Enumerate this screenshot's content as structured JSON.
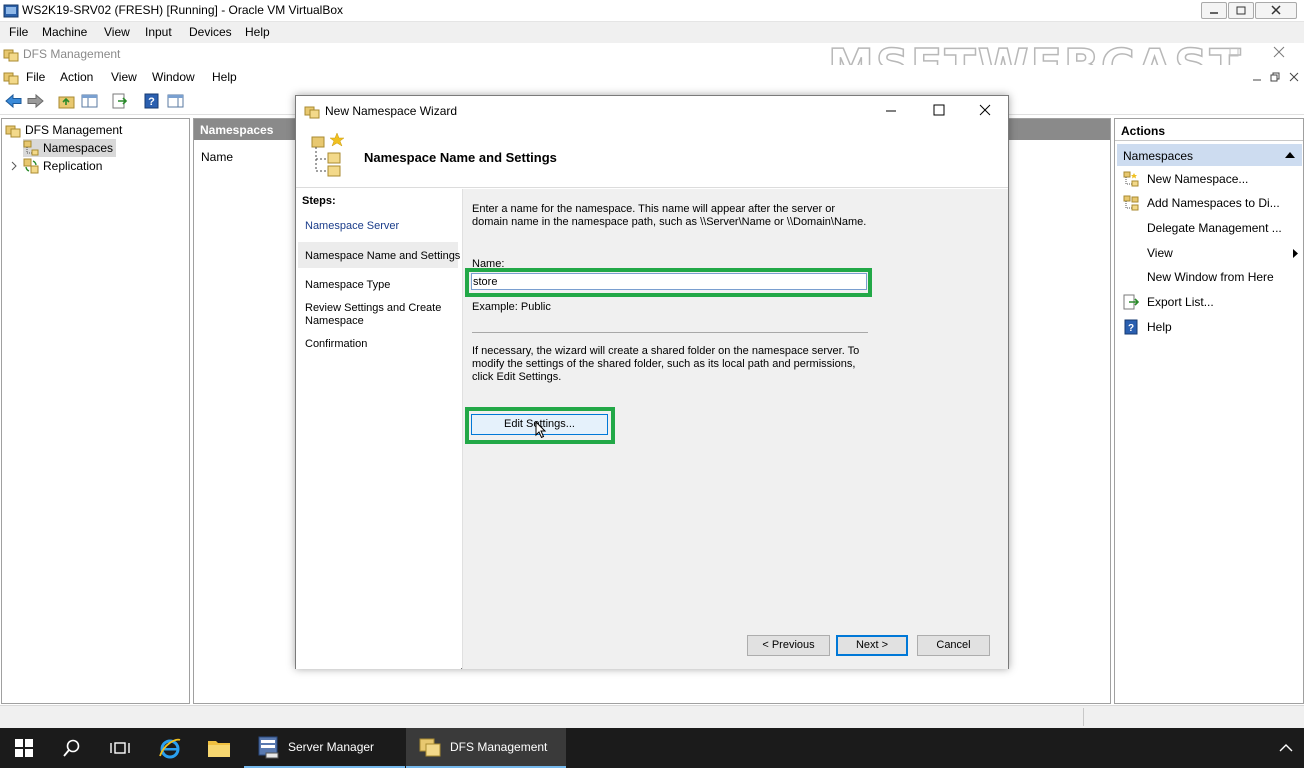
{
  "vbox": {
    "title": "WS2K19-SRV02 (FRESH) [Running] - Oracle VM VirtualBox",
    "menu": [
      "File",
      "Machine",
      "View",
      "Input",
      "Devices",
      "Help"
    ]
  },
  "mmc": {
    "title": "DFS Management",
    "menu": [
      "File",
      "Action",
      "View",
      "Window",
      "Help"
    ],
    "watermark": "MSFTWEBCAST"
  },
  "tree": {
    "root": "DFS Management",
    "items": [
      "Namespaces",
      "Replication"
    ]
  },
  "center": {
    "header": "Namespaces",
    "column": "Name"
  },
  "actions": {
    "header": "Actions",
    "section": "Namespaces",
    "items": [
      {
        "label": "New Namespace...",
        "icon": "new-namespace-icon"
      },
      {
        "label": "Add Namespaces to Di...",
        "icon": "add-namespace-icon"
      },
      {
        "label": "Delegate Management ...",
        "icon": ""
      },
      {
        "label": "View",
        "icon": "",
        "submenu": true
      },
      {
        "label": "New Window from Here",
        "icon": ""
      },
      {
        "label": "Export List...",
        "icon": "export-icon"
      },
      {
        "label": "Help",
        "icon": "help-icon"
      }
    ]
  },
  "wizard": {
    "title": "New Namespace Wizard",
    "heading": "Namespace Name and Settings",
    "steps_label": "Steps:",
    "steps": [
      "Namespace Server",
      "Namespace Name and Settings",
      "Namespace Type",
      "Review Settings and Create Namespace",
      "Confirmation"
    ],
    "intro": "Enter a name for the namespace. This name will appear after the server or domain name in the namespace path, such as \\\\Server\\Name or \\\\Domain\\Name.",
    "name_label": "Name:",
    "name_value": "store",
    "example": "Example: Public",
    "note": "If necessary, the wizard will create a shared folder on the namespace server. To modify the settings of the shared folder, such as its local path and permissions, click Edit Settings.",
    "edit_settings": "Edit Settings...",
    "previous": "< Previous",
    "next": "Next >",
    "cancel": "Cancel"
  },
  "taskbar": {
    "apps": [
      "Server Manager",
      "DFS Management"
    ]
  },
  "colors": {
    "highlight": "#22a847",
    "selected_step": "#ececec",
    "section_header": "#cddcf0"
  }
}
